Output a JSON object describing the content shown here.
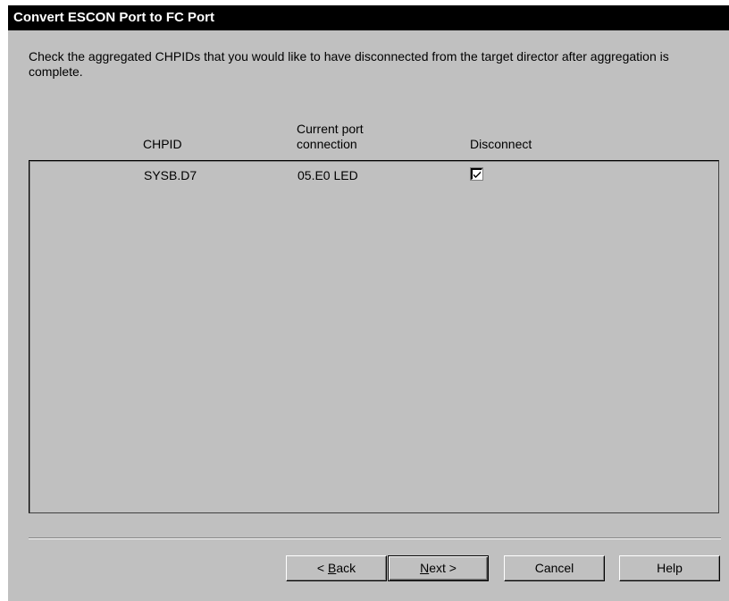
{
  "dialog": {
    "title": "Convert ESCON Port to FC Port",
    "instructions": "Check the aggregated CHPIDs that you would like to have disconnected from the target director after aggregation is complete."
  },
  "table": {
    "columns": {
      "chpid": "CHPID",
      "connection_line1": "Current port",
      "connection_line2": "connection",
      "disconnect": "Disconnect"
    },
    "rows": [
      {
        "chpid": "SYSB.D7",
        "connection": "05.E0 LED",
        "disconnect": true
      }
    ]
  },
  "buttons": {
    "back_prefix": "< ",
    "back_mnemonic": "B",
    "back_rest": "ack",
    "next_mnemonic": "N",
    "next_rest": "ext >",
    "cancel": "Cancel",
    "help": "Help"
  }
}
